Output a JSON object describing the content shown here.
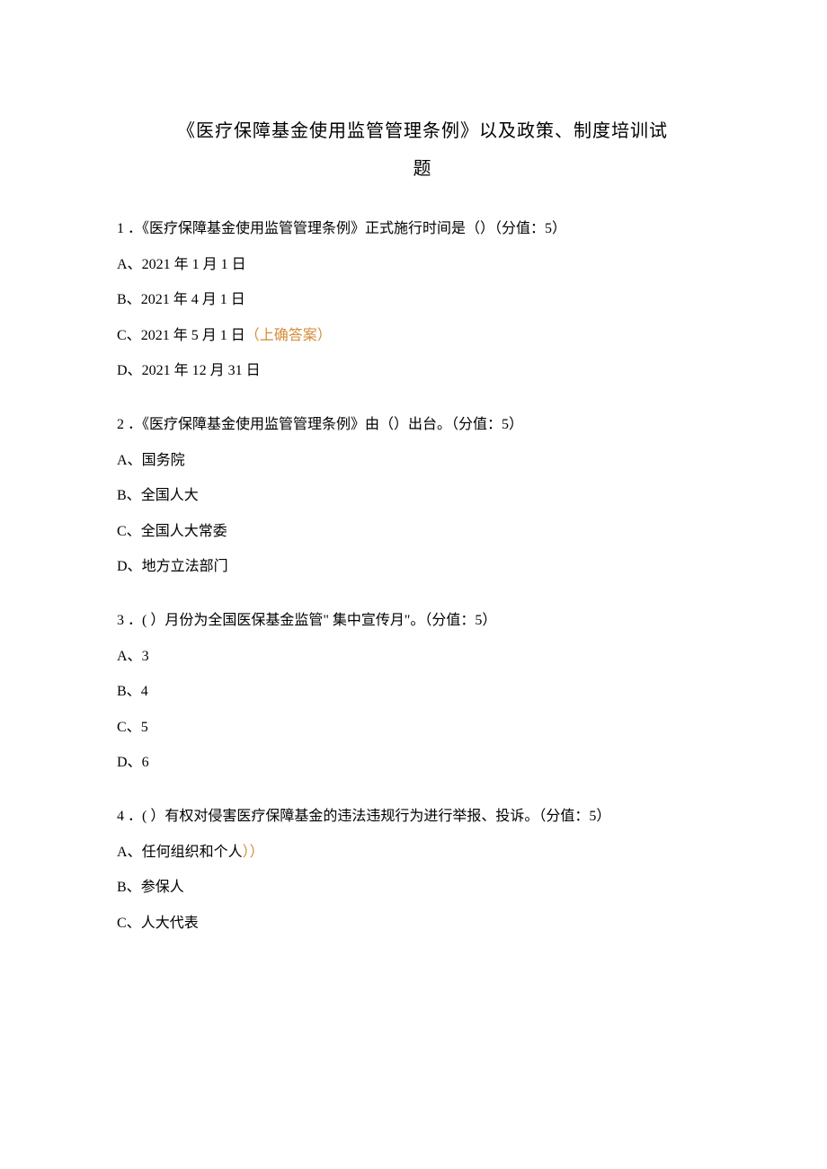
{
  "title_line1": "《医疗保障基金使用监管管理条例》以及政策、制度培训试",
  "title_line2": "题",
  "questions": [
    {
      "stem": "1 ．《医疗保障基金使用监管管理条例》正式施行时间是（）（分值：5）",
      "options": [
        {
          "label": "A、",
          "text": "2021 年 1 月 1 日",
          "hint": ""
        },
        {
          "label": "B、",
          "text": "2021 年 4 月 1 日",
          "hint": ""
        },
        {
          "label": "C、",
          "text": "2021 年 5 月 1 日",
          "hint": "（上确答案）"
        },
        {
          "label": "D、",
          "text": "2021 年 12 月 31 日",
          "hint": ""
        }
      ]
    },
    {
      "stem": "2 ．《医疗保障基金使用监管管理条例》由（）出台。（分值：5）",
      "options": [
        {
          "label": "A、",
          "text": "国务院",
          "hint": ""
        },
        {
          "label": "B、",
          "text": "全国人大",
          "hint": ""
        },
        {
          "label": "C、",
          "text": "全国人大常委",
          "hint": ""
        },
        {
          "label": "D、",
          "text": "地方立法部门",
          "hint": ""
        }
      ]
    },
    {
      "stem": "3 ．( ）月份为全国医保基金监管\" 集中宣传月\"。（分值：5）",
      "options": [
        {
          "label": "A、",
          "text": "3",
          "hint": ""
        },
        {
          "label": "B、",
          "text": "4",
          "hint": ""
        },
        {
          "label": "C、",
          "text": "5",
          "hint": ""
        },
        {
          "label": "D、",
          "text": "6",
          "hint": ""
        }
      ]
    },
    {
      "stem": "4 ．( ）有权对侵害医疗保障基金的违法违规行为进行举报、投诉。（分值：5）",
      "options": [
        {
          "label": "A、",
          "text": "任何组织和个人",
          "hint": "））"
        },
        {
          "label": "B、",
          "text": "参保人",
          "hint": ""
        },
        {
          "label": "C、",
          "text": "人大代表",
          "hint": ""
        }
      ]
    }
  ]
}
